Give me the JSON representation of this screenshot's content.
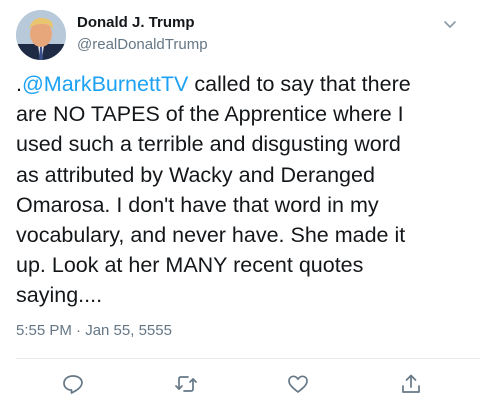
{
  "author": {
    "name": "Donald J. Trump",
    "handle": "@realDonaldTrump"
  },
  "tweet": {
    "lines": [
      {
        "prefix": ".",
        "mention": "@MarkBurnettTV",
        "text": " called to say that there"
      },
      {
        "text": "are NO TAPES of the Apprentice where I"
      },
      {
        "text": "used such a terrible and disgusting word"
      },
      {
        "text": "as attributed by Wacky and Deranged"
      },
      {
        "text": "Omarosa. I don't have that word in my"
      },
      {
        "text": "vocabulary, and never have. She made it"
      },
      {
        "text": "up. Look at her MANY recent quotes"
      },
      {
        "text": "saying...."
      }
    ],
    "timestamp": "5:55 PM · Jan 55, 5555"
  },
  "icons": {
    "caret": "chevron-down-icon",
    "reply": "reply-icon",
    "retweet": "retweet-icon",
    "like": "like-icon",
    "share": "share-icon"
  },
  "colors": {
    "mention": "#1da1f2",
    "secondary_text": "#657786",
    "icon": "#657786"
  }
}
